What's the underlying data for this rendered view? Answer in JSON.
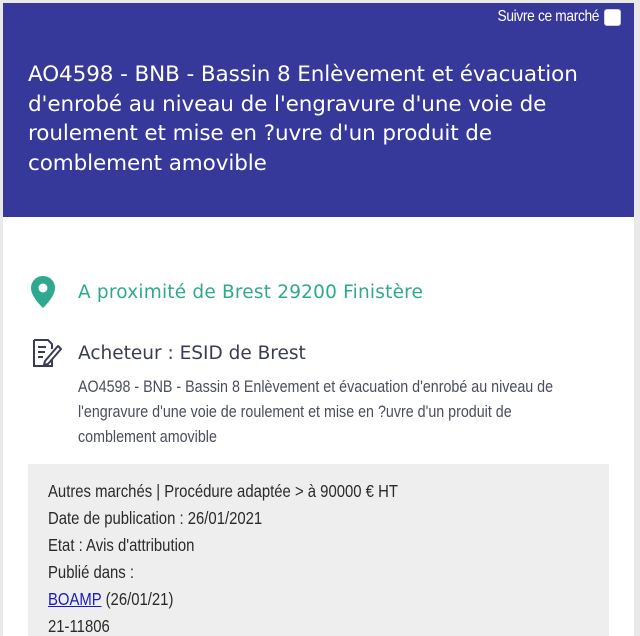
{
  "header": {
    "follow_label": "Suivre ce marché",
    "title": "AO4598 - BNB - Bassin 8 Enlèvement et évacuation d'enrobé au niveau de l'engravure d'une voie de roulement et mise en ?uvre d'un produit de comblement amovible"
  },
  "details": {
    "location": "A proximité de Brest 29200 Finistère",
    "buyer": "Acheteur : ESID de Brest",
    "description_lines": [
      "AO4598 - BNB - Bassin 8 Enlèvement et évacuation d'enrobé au niveau de",
      "l'engravure d'une voie de roulement et mise en ?uvre d'un produit de",
      "comblement amovible"
    ]
  },
  "info": {
    "procedure": "Autres marchés | Procédure adaptée > à 90000 € HT",
    "publication_date": "Date de publication : 26/01/2021",
    "status": "Etat : Avis d'attribution",
    "published_in": "Publié dans :",
    "source_link": "BOAMP",
    "source_date": " (26/01/21)",
    "reference": "21-11806"
  },
  "colors": {
    "header_bg": "#37399a",
    "location_accent": "#2fa98e",
    "link": "#1a1ac8"
  },
  "icons": [
    "map-pin-icon",
    "document-edit-icon"
  ]
}
